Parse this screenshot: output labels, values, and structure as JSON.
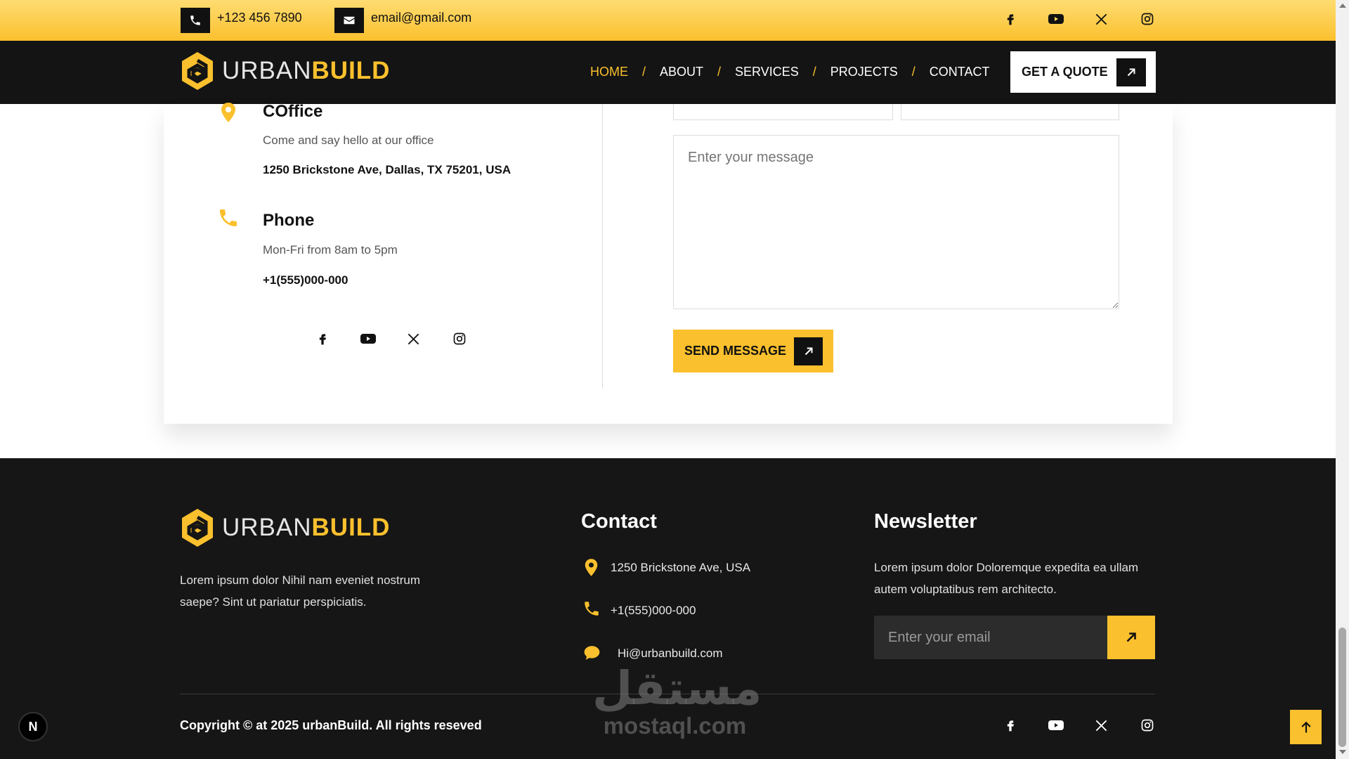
{
  "topbar": {
    "phone": "+123 456 7890",
    "email": "email@gmail.com",
    "social": [
      "facebook-icon",
      "youtube-icon",
      "x-icon",
      "instagram-icon"
    ]
  },
  "brand": {
    "part1": "URBAN",
    "part2": "BUILD"
  },
  "nav": {
    "items": [
      "HOME",
      "ABOUT",
      "SERVICES",
      "PROJECTS",
      "CONTACT"
    ],
    "separator": "/",
    "active": "HOME",
    "quote_label": "GET A QUOTE"
  },
  "contact_info": {
    "office": {
      "title": "COffice",
      "subtitle": "Come and say hello at our office",
      "value": "1250 Brickstone Ave, Dallas, TX 75201, USA"
    },
    "phone": {
      "title": "Phone",
      "subtitle": "Mon-Fri from 8am to 5pm",
      "value": "+1(555)000-000"
    }
  },
  "form": {
    "message_placeholder": "Enter your message",
    "send_label": "SEND MESSAGE"
  },
  "footer": {
    "description": "Lorem ipsum dolor Nihil nam eveniet nostrum saepe? Sint ut pariatur perspiciatis.",
    "contact": {
      "heading": "Contact",
      "address": "1250 Brickstone Ave, USA",
      "phone": "+1(555)000-000",
      "email": "Hi@urbanbuild.com"
    },
    "newsletter": {
      "heading": "Newsletter",
      "description": "Lorem ipsum dolor Doloremque expedita ea ullam autem voluptatibus rem architecto.",
      "email_placeholder": "Enter your email"
    },
    "copyright": "Copyright © at 2025 urbanBuild. All rights reseved"
  },
  "watermark": {
    "arabic": "مستقل",
    "latin": "mostaql.com"
  },
  "colors": {
    "accent": "#fbc02d",
    "dark": "#141414",
    "footer": "#161616"
  }
}
